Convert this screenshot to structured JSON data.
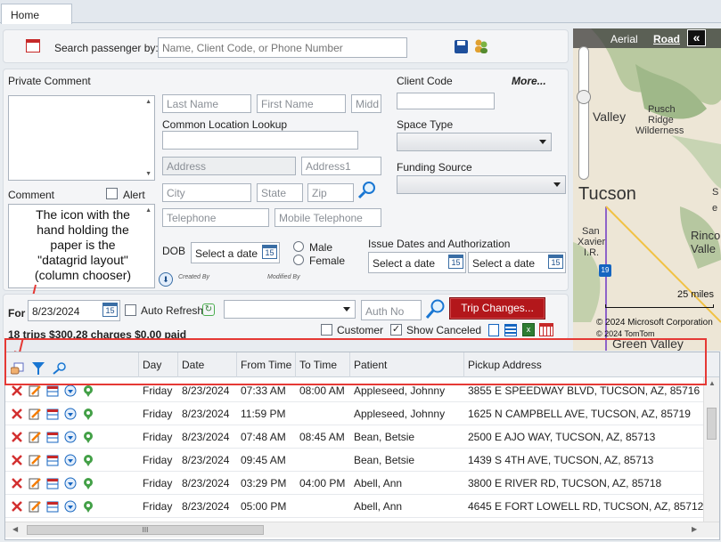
{
  "tabs": [
    {
      "label": "Home"
    }
  ],
  "search": {
    "label": "Search passenger by:",
    "placeholder": "Name, Client Code, or Phone Number"
  },
  "form": {
    "private_comment_label": "Private Comment",
    "comment_label": "Comment",
    "alert_label": "Alert",
    "callout_text": "The icon with the hand holding the paper is the \"datagrid layout\" (column chooser)",
    "last_name": "Last Name",
    "first_name": "First Name",
    "middle": "Midd",
    "common_location_label": "Common Location Lookup",
    "address": "Address",
    "address1": "Address1",
    "city": "City",
    "state": "State",
    "zip": "Zip",
    "telephone": "Telephone",
    "mobile_telephone": "Mobile Telephone",
    "dob_label": "DOB",
    "dob_placeholder": "Select a date",
    "male_label": "Male",
    "female_label": "Female",
    "created_by": "Created By",
    "modified_by": "Modified By",
    "client_code_label": "Client Code",
    "more_label": "More...",
    "space_type_label": "Space Type",
    "funding_source_label": "Funding Source",
    "issue_dates_label": "Issue Dates and Authorization",
    "issue_date1": "Select a date",
    "issue_date2": "Select a date"
  },
  "toolbar": {
    "for_label": "For",
    "date": "8/23/2024",
    "auto_refresh_label": "Auto Refresh",
    "auth_no_placeholder": "Auth No",
    "trip_changes_label": "Trip Changes...",
    "summary": "18 trips $300.28 charges $0.00 paid",
    "customer_label": "Customer",
    "show_canceled_label": "Show Canceled",
    "show_canceled_checked": true
  },
  "map": {
    "aerial_label": "Aerial",
    "road_label": "Road",
    "collapse_label": "«",
    "scale_label": "25 miles",
    "copyright1": "© 2024 Microsoft Corporation",
    "copyright2": "© 2024 TomTom",
    "places": {
      "valley": "Valley",
      "pusch": "Pusch",
      "ridge": "Ridge",
      "wilderness": "Wilderness",
      "tucson": "Tucson",
      "san": "San",
      "xavier": "Xavier",
      "ir": "I.R.",
      "rinco": "Rinco",
      "valle": "Valle",
      "s": "S",
      "e": "e",
      "green_valley": "Green Valley",
      "route": "19"
    }
  },
  "grid": {
    "columns": [
      "Day",
      "Date",
      "From Time",
      "To Time",
      "Patient",
      "Pickup Address"
    ],
    "rows": [
      {
        "day": "Friday",
        "date": "8/23/2024",
        "from": "07:33 AM",
        "to": "08:00 AM",
        "patient": "Appleseed, Johnny",
        "pickup": "3855 E SPEEDWAY BLVD, TUCSON, AZ, 85716"
      },
      {
        "day": "Friday",
        "date": "8/23/2024",
        "from": "11:59 PM",
        "to": "",
        "patient": "Appleseed, Johnny",
        "pickup": "1625 N CAMPBELL AVE, TUCSON, AZ, 85719"
      },
      {
        "day": "Friday",
        "date": "8/23/2024",
        "from": "07:48 AM",
        "to": "08:45 AM",
        "patient": "Bean, Betsie",
        "pickup": "2500 E AJO WAY, TUCSON, AZ, 85713"
      },
      {
        "day": "Friday",
        "date": "8/23/2024",
        "from": "09:45 AM",
        "to": "",
        "patient": "Bean, Betsie",
        "pickup": "1439 S 4TH AVE, TUCSON, AZ, 85713"
      },
      {
        "day": "Friday",
        "date": "8/23/2024",
        "from": "03:29 PM",
        "to": "04:00 PM",
        "patient": "Abell, Ann",
        "pickup": "3800 E RIVER RD, TUCSON, AZ, 85718"
      },
      {
        "day": "Friday",
        "date": "8/23/2024",
        "from": "05:00 PM",
        "to": "",
        "patient": "Abell, Ann",
        "pickup": "4645 E FORT LOWELL RD, TUCSON, AZ, 85712"
      }
    ],
    "scrollbar_grip": "III"
  },
  "colors": {
    "accent_red": "#b3171b",
    "annotation_red": "#e53935",
    "icon_blue": "#1565c0",
    "icon_green": "#43a047"
  }
}
